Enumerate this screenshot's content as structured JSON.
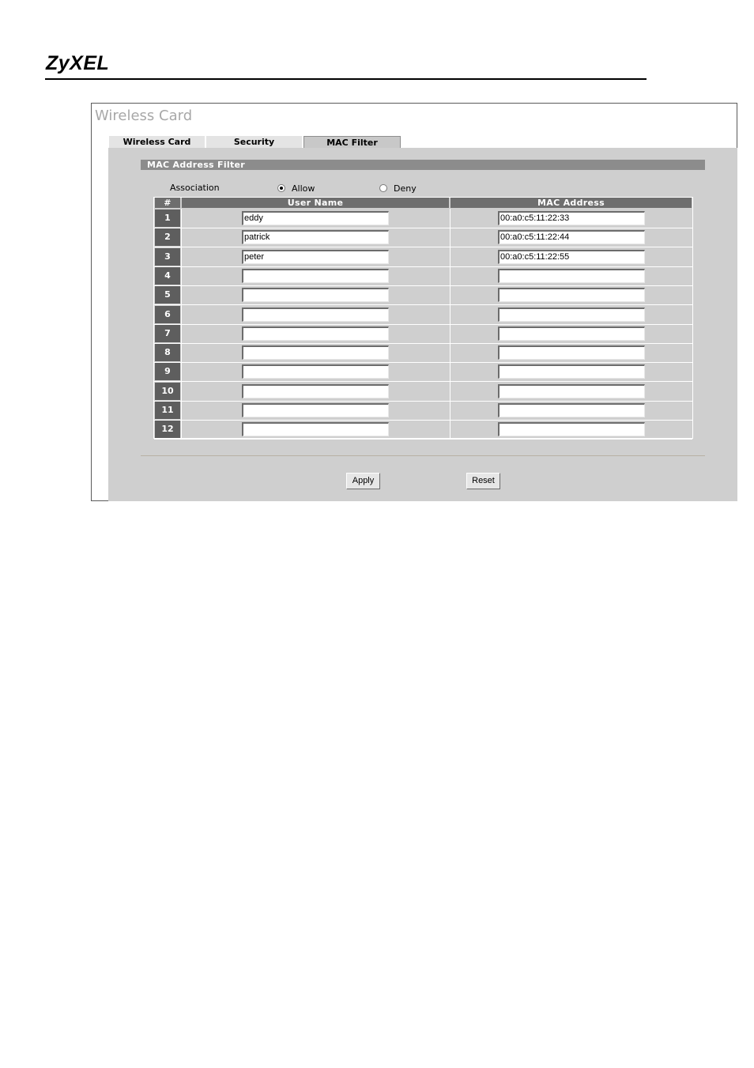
{
  "brand": "ZyXEL",
  "page_title": "Wireless Card",
  "tabs": [
    {
      "label": "Wireless Card",
      "active": false
    },
    {
      "label": "Security",
      "active": false
    },
    {
      "label": "MAC Filter",
      "active": true
    }
  ],
  "section_title": "MAC Address Filter",
  "association": {
    "label": "Association",
    "options": [
      {
        "label": "Allow",
        "checked": true
      },
      {
        "label": "Deny",
        "checked": false
      }
    ]
  },
  "table": {
    "headers": [
      "#",
      "User Name",
      "MAC Address"
    ],
    "rows": [
      {
        "num": "1",
        "user": "eddy",
        "mac": "00:a0:c5:11:22:33"
      },
      {
        "num": "2",
        "user": "patrick",
        "mac": "00:a0:c5:11:22:44"
      },
      {
        "num": "3",
        "user": "peter",
        "mac": "00:a0:c5:11:22:55"
      },
      {
        "num": "4",
        "user": "",
        "mac": ""
      },
      {
        "num": "5",
        "user": "",
        "mac": ""
      },
      {
        "num": "6",
        "user": "",
        "mac": ""
      },
      {
        "num": "7",
        "user": "",
        "mac": ""
      },
      {
        "num": "8",
        "user": "",
        "mac": ""
      },
      {
        "num": "9",
        "user": "",
        "mac": ""
      },
      {
        "num": "10",
        "user": "",
        "mac": ""
      },
      {
        "num": "11",
        "user": "",
        "mac": ""
      },
      {
        "num": "12",
        "user": "",
        "mac": ""
      }
    ]
  },
  "buttons": {
    "apply": "Apply",
    "reset": "Reset"
  }
}
